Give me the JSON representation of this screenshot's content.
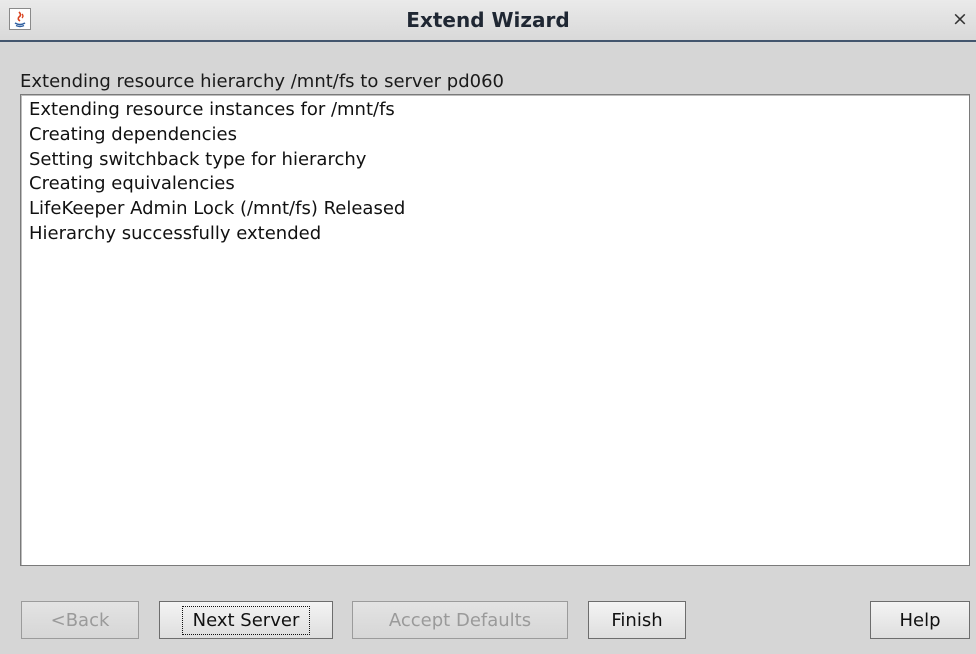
{
  "window": {
    "title": "Extend Wizard",
    "close_symbol": "×",
    "icon": "java-icon"
  },
  "heading": "Extending resource hierarchy /mnt/fs to server pd060",
  "log": [
    "Extending resource instances for /mnt/fs",
    "Creating dependencies",
    "Setting switchback type for hierarchy",
    "Creating equivalencies",
    "LifeKeeper Admin Lock (/mnt/fs) Released",
    "Hierarchy successfully extended"
  ],
  "buttons": {
    "back": "<Back",
    "next_server": "Next Server",
    "accept_defaults": "Accept Defaults",
    "finish": "Finish",
    "help": "Help"
  },
  "colors": {
    "window_bg": "#d6d6d6",
    "title_underline": "#43566e",
    "disabled_text": "#9a9a9a"
  }
}
